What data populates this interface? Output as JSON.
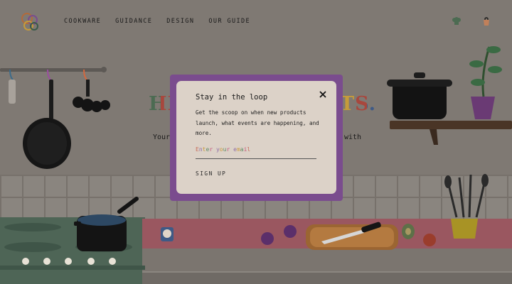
{
  "nav": {
    "links": [
      "COOKWARE",
      "GUIDANCE",
      "DESIGN",
      "OUR GUIDE"
    ]
  },
  "hero": {
    "title_left": "HI,",
    "title_right": "TS.",
    "subtitle_left": "Your",
    "subtitle_right": "with"
  },
  "modal": {
    "title": "Stay in the loop",
    "body": "Get the scoop on when new products launch, what events are happening, and more.",
    "email_placeholder": "Enter your email",
    "signup_label": "SIGN UP"
  },
  "colors": {
    "modal_frame": "#7a4c8e",
    "modal_background": "#dcd2c8",
    "wall": "#7f7973",
    "counter_left": "#4e6556",
    "counter_right": "#9a5760"
  }
}
